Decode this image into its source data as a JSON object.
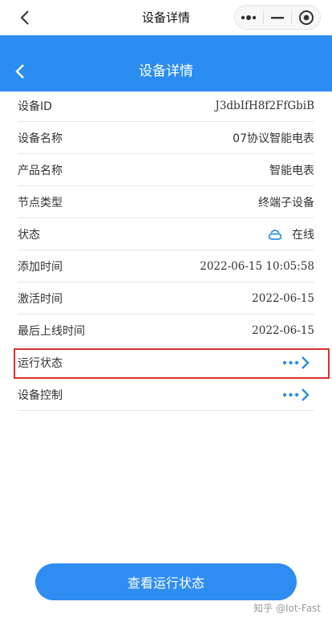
{
  "topbar": {
    "title": "设备详情"
  },
  "header": {
    "title": "设备详情"
  },
  "rows": [
    {
      "label": "设备ID",
      "value": "J3dbIfH8f2FfGbiB"
    },
    {
      "label": "设备名称",
      "value": "07协议智能电表"
    },
    {
      "label": "产品名称",
      "value": "智能电表"
    },
    {
      "label": "节点类型",
      "value": "终端子设备"
    },
    {
      "label": "状态",
      "value": "在线",
      "icon": "cloud-icon"
    },
    {
      "label": "添加时间",
      "value": "2022-06-15 10:05:58"
    },
    {
      "label": "激活时间",
      "value": "2022-06-15"
    },
    {
      "label": "最后上线时间",
      "value": "2022-06-15"
    },
    {
      "label": "运行状态",
      "icon": "more-arrow-icon"
    },
    {
      "label": "设备控制",
      "icon": "more-arrow-icon"
    }
  ],
  "bottom_button": {
    "label": "查看运行状态"
  },
  "watermark": "知乎 @Iot-Fast",
  "colors": {
    "brand": "#2c8df0",
    "highlight": "#d9302e"
  }
}
